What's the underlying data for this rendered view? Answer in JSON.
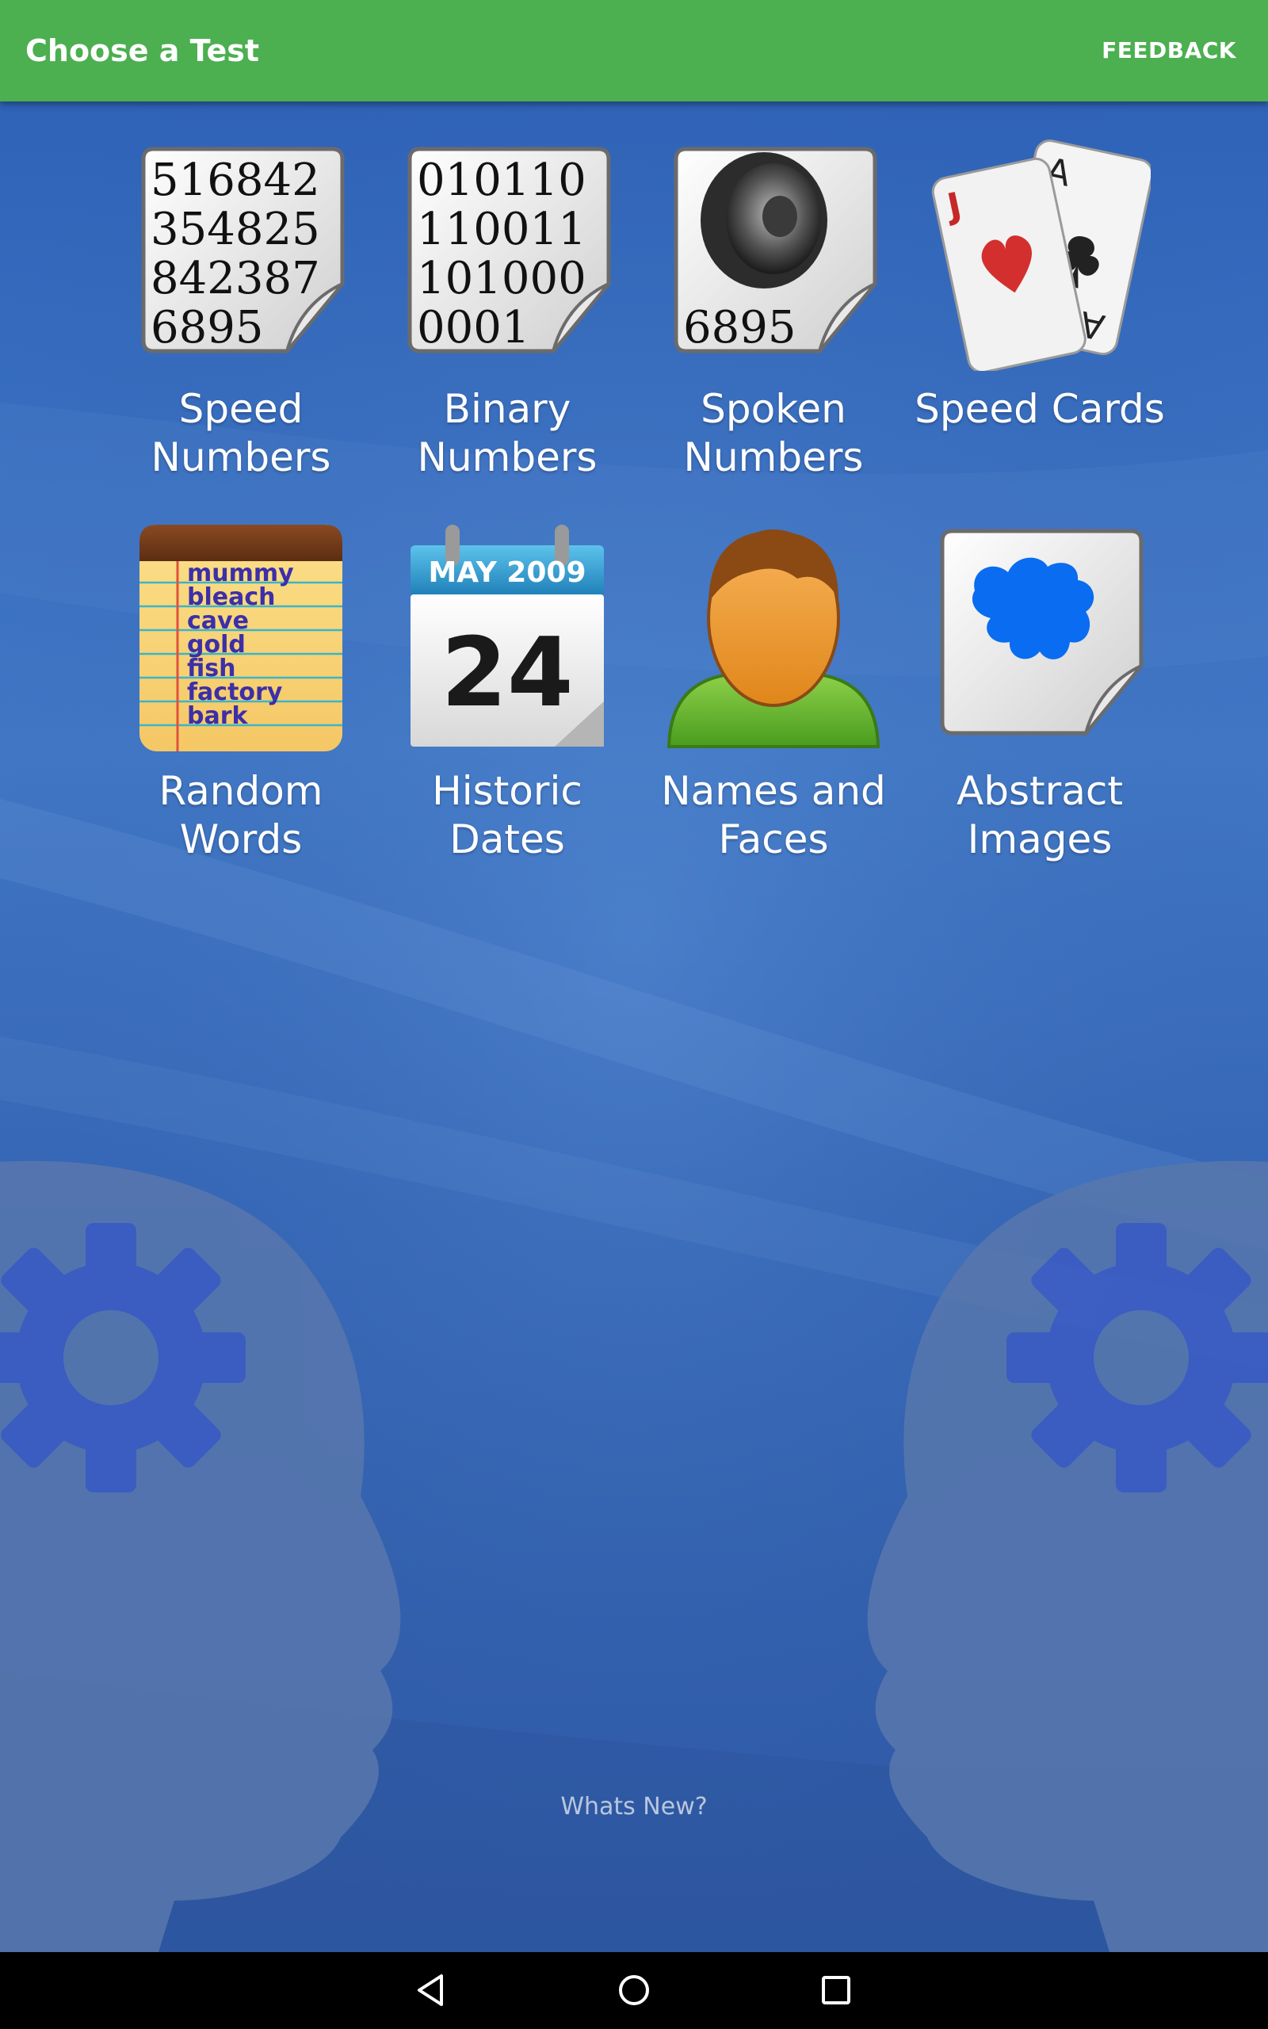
{
  "app_bar": {
    "title": "Choose a Test",
    "feedback_label": "FEEDBACK",
    "color": "#4caf50"
  },
  "tests": [
    {
      "line1": "Speed",
      "line2": "Numbers",
      "icon": "number-document-icon",
      "icon_text": [
        "516842",
        "354825",
        "842387",
        "6895"
      ]
    },
    {
      "line1": "Binary",
      "line2": "Numbers",
      "icon": "binary-document-icon",
      "icon_text": [
        "010110",
        "110011",
        "101000",
        "0001"
      ]
    },
    {
      "line1": "Spoken",
      "line2": "Numbers",
      "icon": "speaker-document-icon",
      "icon_text": [
        "6895"
      ]
    },
    {
      "line1": "Speed Cards",
      "line2": "",
      "icon": "playing-cards-icon",
      "icon_text": [
        "J",
        "A",
        "A"
      ]
    },
    {
      "line1": "Random",
      "line2": "Words",
      "icon": "notepad-words-icon",
      "icon_text": [
        "mummy",
        "bleach",
        "cave",
        "gold",
        "fish",
        "factory",
        "bark"
      ]
    },
    {
      "line1": "Historic",
      "line2": "Dates",
      "icon": "calendar-icon",
      "icon_text": [
        "MAY 2009",
        "24"
      ]
    },
    {
      "line1": "Names and",
      "line2": "Faces",
      "icon": "person-icon",
      "icon_text": []
    },
    {
      "line1": "Abstract",
      "line2": "Images",
      "icon": "abstract-blot-document-icon",
      "icon_text": []
    }
  ],
  "footer": {
    "whats_new": "Whats New?"
  },
  "nav": {
    "back": "back-icon",
    "home": "home-icon",
    "recents": "recents-icon"
  }
}
